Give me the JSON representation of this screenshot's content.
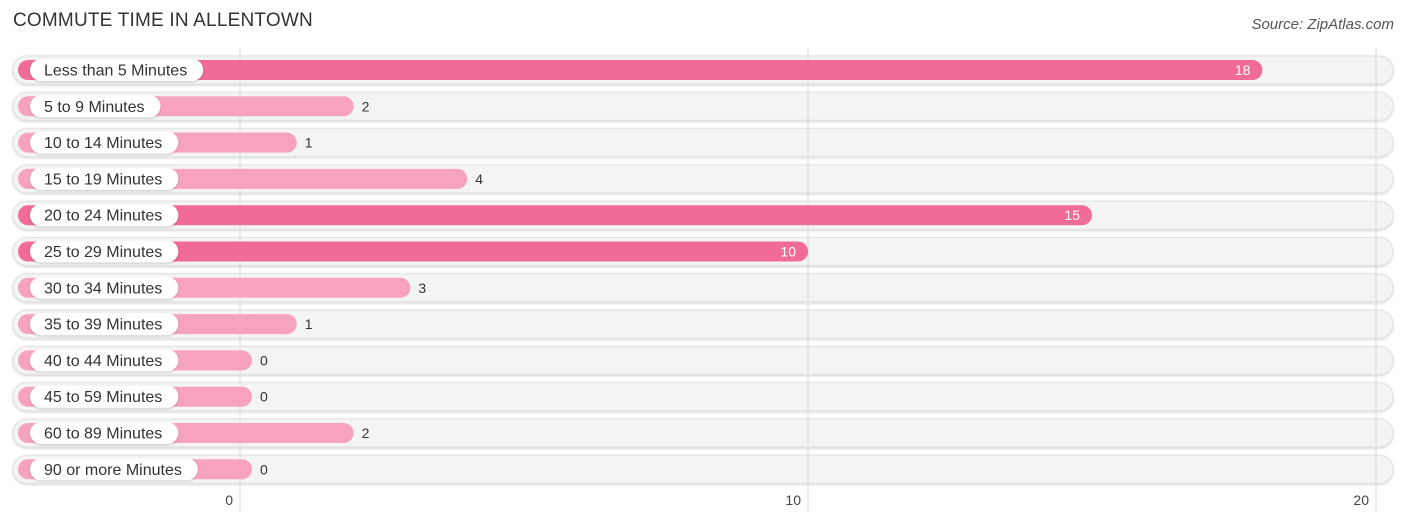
{
  "header": {
    "title": "COMMUTE TIME IN ALLENTOWN",
    "source": "Source: ZipAtlas.com"
  },
  "chart_data": {
    "type": "bar",
    "orientation": "horizontal",
    "title": "COMMUTE TIME IN ALLENTOWN",
    "xlabel": "",
    "ylabel": "",
    "xlim": [
      0,
      20
    ],
    "x_ticks": [
      0,
      10,
      20
    ],
    "grid": true,
    "categories": [
      "Less than 5 Minutes",
      "5 to 9 Minutes",
      "10 to 14 Minutes",
      "15 to 19 Minutes",
      "20 to 24 Minutes",
      "25 to 29 Minutes",
      "30 to 34 Minutes",
      "35 to 39 Minutes",
      "40 to 44 Minutes",
      "45 to 59 Minutes",
      "60 to 89 Minutes",
      "90 or more Minutes"
    ],
    "values": [
      18,
      2,
      1,
      4,
      15,
      10,
      3,
      1,
      0,
      0,
      2,
      0
    ],
    "colors": {
      "high": "#f06b95",
      "low": "#f7a3bd",
      "track": "#f4f4f4",
      "label_inside": "#ffffff",
      "label_outside": "#333333"
    }
  }
}
